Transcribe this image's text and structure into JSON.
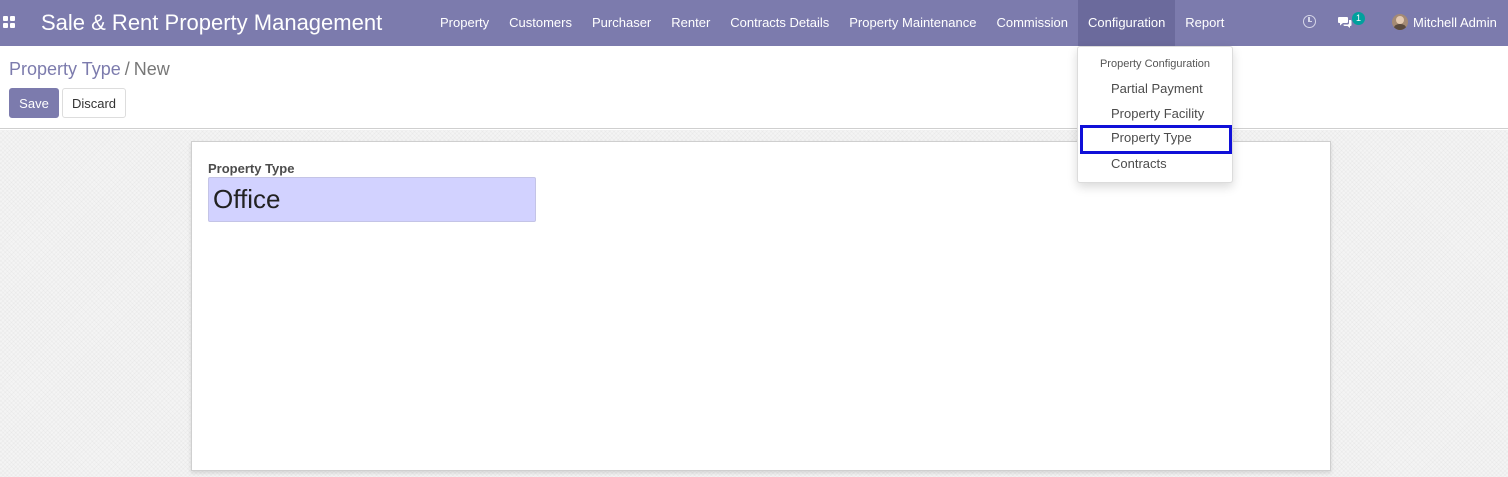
{
  "navbar": {
    "app_title": "Sale & Rent Property Management",
    "menu_items": [
      "Property",
      "Customers",
      "Purchaser",
      "Renter",
      "Contracts Details",
      "Property Maintenance",
      "Commission",
      "Configuration",
      "Report"
    ],
    "active_menu": "Configuration",
    "chat_badge_count": "1",
    "user_name": "Mitchell Admin",
    "color": "#7c7bad"
  },
  "breadcrumb": {
    "parent": "Property Type",
    "separator": "/",
    "current": "New"
  },
  "buttons": {
    "save": "Save",
    "discard": "Discard"
  },
  "form": {
    "property_type_label": "Property Type",
    "property_type_value": "Office"
  },
  "configuration_dropdown": {
    "header": "Property Configuration",
    "items": [
      "Partial Payment",
      "Property Facility",
      "Property Type",
      "Contracts"
    ],
    "highlighted_item": "Property Type"
  },
  "colors": {
    "brand": "#7c7bad",
    "input_highlight": "#d2d2ff",
    "badge": "#00a09d",
    "selection_box": "#1010d8"
  }
}
